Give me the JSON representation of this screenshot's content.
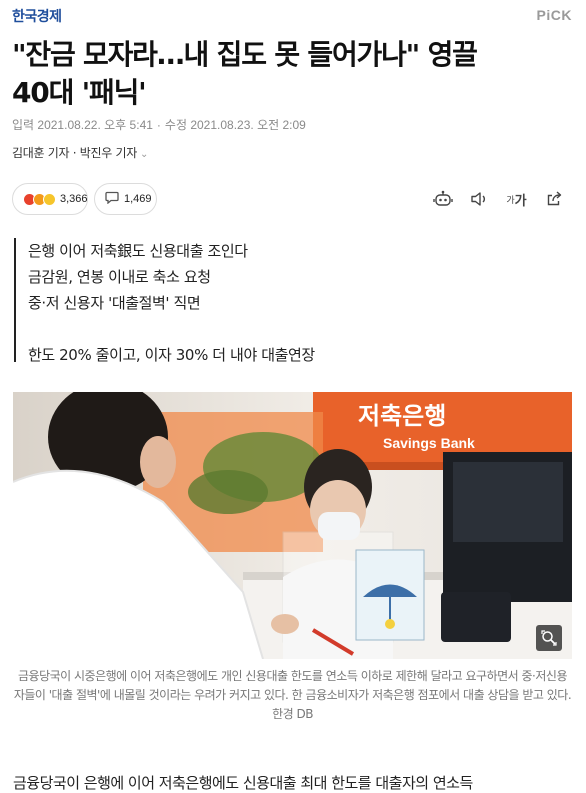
{
  "header": {
    "logo_text": "한국경제",
    "pick_label": "PiCK"
  },
  "article": {
    "headline_line1": "\"잔금 모자라…내 집도 못 들어가나\" 영끌",
    "headline_line2": "40대 '패닉'",
    "input_label": "입력 2021.08.22. 오후 5:41",
    "modified_label": "수정 2021.08.23. 오전 2:09",
    "meta_separator": "·",
    "reporters": "김대훈 기자 · 박진우 기자",
    "reaction_count": "3,366",
    "comment_count": "1,469",
    "text_size_label": "가",
    "summary": [
      "은행 이어 저축銀도 신용대출 조인다",
      "금감원, 연봉 이내로 축소 요청",
      "중·저 신용자 '대출절벽' 직면",
      "한도 20% 줄이고, 이자 30% 더 내야 대출연장"
    ],
    "photo_sign_text": "저축은행",
    "photo_sign_sub": "Savings Bank",
    "caption": "금융당국이 시중은행에 이어 저축은행에도 개인 신용대출 한도를 연소득 이하로 제한해 달라고 요구하면서 중·저신용자들이 '대출 절벽'에 내몰릴 것이라는 우려가 커지고 있다. 한 금융소비자가 저축은행 점포에서 대출 상담을 받고 있다. 한경 DB",
    "body_first_line": "금융당국이 은행에 이어 저축은행에도 신용대출 최대 한도를 대출자의 연소득"
  },
  "colors": {
    "logo": "#1f4e9c",
    "pick": "#9a9a9a",
    "bank_orange": "#e8622a",
    "meta_gray": "#8a8a8a"
  },
  "icons": {
    "reaction": "emoji-reaction-icon",
    "comment": "comment-bubble-icon",
    "tts": "robot-read-icon",
    "audio": "speaker-icon",
    "text_size": "text-size-icon",
    "share": "share-icon",
    "zoom": "zoom-icon"
  }
}
